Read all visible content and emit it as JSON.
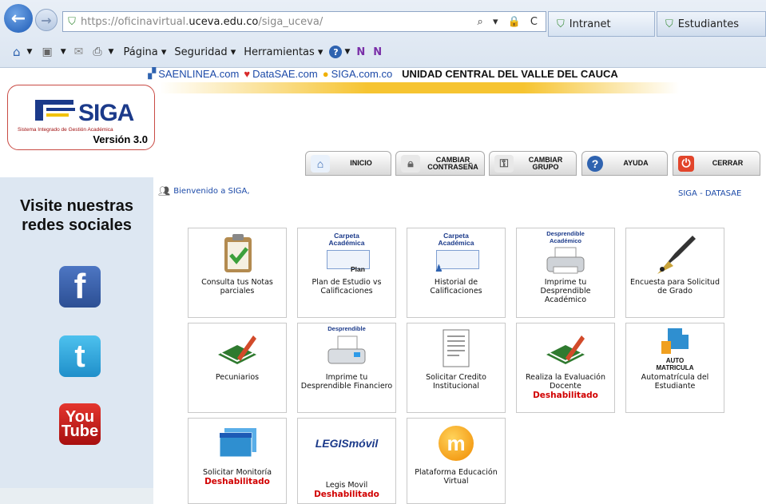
{
  "browser": {
    "url_prefix": "https://oficinavirtual.",
    "url_domain": "uceva.edu.co",
    "url_path": "/siga_uceva/",
    "address_controls": "⌕ ▾ 🔒 C",
    "tabs": [
      {
        "label": "Intranet"
      },
      {
        "label": "Estudiantes"
      }
    ],
    "menu": [
      "Página ▾",
      "Seguridad ▾",
      "Herramientas ▾"
    ]
  },
  "site": {
    "links": [
      "SAENLINEA.com",
      "DataSAE.com",
      "SIGA.com.co"
    ],
    "university": "UNIDAD CENTRAL DEL VALLE DEL CAUCA",
    "logo": {
      "brand": "SIGA",
      "subtitle": "Sistema Integrado de Gestión Académica",
      "version": "Versión 3.0"
    },
    "nav": [
      {
        "label": "INICIO",
        "icon": "home-icon"
      },
      {
        "label": "CAMBIAR\nCONTRASEÑA",
        "icon": "lock-icon"
      },
      {
        "label": "CAMBIAR\nGRUPO",
        "icon": "switch-icon"
      },
      {
        "label": "AYUDA",
        "icon": "help-icon"
      },
      {
        "label": "CERRAR",
        "icon": "power-icon"
      }
    ],
    "sidebar_title": "Visite nuestras redes sociales",
    "social": [
      "f",
      "t",
      "You\nTube"
    ],
    "welcome": "Bienvenido a SIGA,",
    "datasae": "SIGA - DATASAE",
    "disabled_label": "Deshabilitado",
    "cards": [
      {
        "label": "Consulta tus Notas parciales",
        "icon_text": "",
        "disabled": false
      },
      {
        "label": "Plan de Estudio vs Calificaciones",
        "icon_text": "Carpeta Académica",
        "icon_sub": "Plan",
        "disabled": false
      },
      {
        "label": "Historial de Calificaciones",
        "icon_text": "Carpeta Académica",
        "disabled": false
      },
      {
        "label": "Imprime tu Desprendible Académico",
        "icon_text": "Desprendible Académico",
        "disabled": false
      },
      {
        "label": "Encuesta para Solicitud de Grado",
        "icon_text": "",
        "disabled": false
      },
      {
        "label": "Pecuniarios",
        "icon_text": "",
        "disabled": false
      },
      {
        "label": "Imprime tu Desprendible Financiero",
        "icon_text": "Desprendible",
        "disabled": false
      },
      {
        "label": "Solicitar Credito Institucional",
        "icon_text": "",
        "disabled": false
      },
      {
        "label": "Realiza la Evaluación Docente",
        "icon_text": "",
        "disabled": true
      },
      {
        "label": "Automatrícula del Estudiante",
        "icon_text": "AUTO MATRICULA",
        "disabled": false
      },
      {
        "label": "Solicitar Monitoría",
        "icon_text": "",
        "disabled": true
      },
      {
        "label": "Legis Movil",
        "icon_text": "LEGISmóvil",
        "disabled": true
      },
      {
        "label": "Plataforma Educación Virtual",
        "icon_text": "m",
        "disabled": false
      }
    ]
  }
}
